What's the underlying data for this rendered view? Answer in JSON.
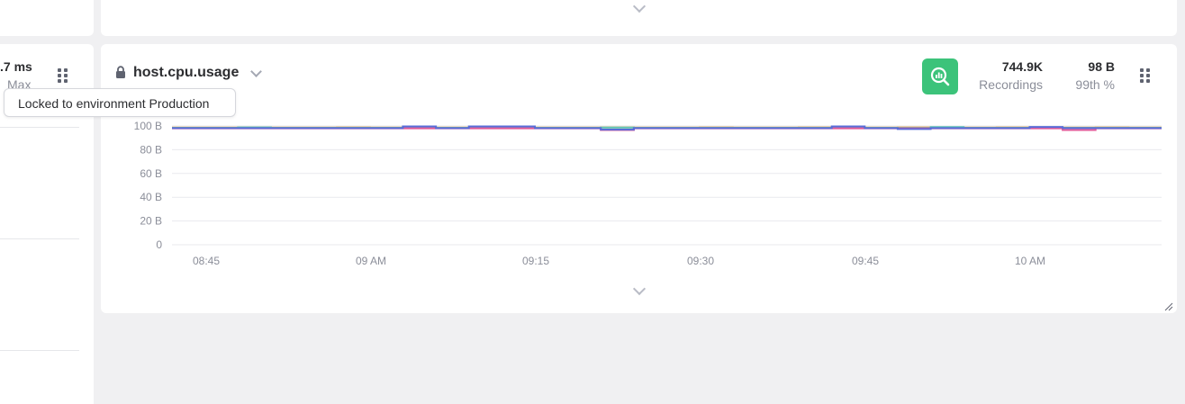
{
  "left_panel": {
    "value": ".7 ms",
    "sublabel": "Max"
  },
  "tooltip": {
    "text": "Locked to environment Production"
  },
  "widget": {
    "title": "host.cpu.usage",
    "accent_color": "#3cc37a",
    "analyze_icon": "analyze-chart-icon",
    "lock_icon": "lock-icon",
    "stats": [
      {
        "value": "744.9K",
        "label": "Recordings"
      },
      {
        "value": "98 B",
        "label": "99th %"
      }
    ]
  },
  "chart_data": {
    "type": "line",
    "y_tick_labels": [
      "100 B",
      "80 B",
      "60 B",
      "40 B",
      "20 B",
      "0"
    ],
    "x_tick_labels": [
      "08:45",
      "09 AM",
      "09:15",
      "09:30",
      "09:45",
      "10 AM"
    ],
    "ylim": [
      0,
      100
    ],
    "grid": true,
    "series": [
      {
        "color": "#e8a33c",
        "values": [
          98.6,
          98.6,
          98.8,
          98.6,
          98.6,
          98.8,
          98.6,
          98.8,
          98.6,
          98.6,
          98.8,
          98.6,
          98.6,
          98.8,
          98.6,
          98.6,
          98.8,
          98.6,
          98.6,
          98.8,
          98.6,
          98.6,
          98.8,
          98.6,
          98.6,
          98.8,
          98.6,
          98.6,
          98.8,
          98.6
        ]
      },
      {
        "color": "#5cc2b4",
        "values": [
          98.4,
          98.4,
          98.8,
          98.4,
          98.4,
          98.4,
          98.4,
          99.0,
          98.4,
          98.4,
          98.4,
          98.4,
          98.4,
          98.6,
          98.4,
          98.4,
          98.4,
          98.4,
          98.4,
          98.4,
          98.6,
          98.4,
          98.4,
          99.0,
          98.4,
          98.4,
          98.4,
          98.4,
          98.4,
          98.4
        ]
      },
      {
        "color": "#e05a9a",
        "values": [
          98.0,
          98.0,
          98.0,
          98.0,
          98.0,
          98.0,
          98.0,
          98.0,
          98.0,
          98.0,
          98.0,
          98.0,
          98.0,
          96.6,
          98.0,
          98.0,
          98.0,
          98.0,
          98.0,
          98.0,
          98.0,
          98.0,
          98.0,
          98.0,
          98.0,
          98.0,
          98.0,
          96.6,
          98.0,
          98.0
        ]
      },
      {
        "color": "#5a6cd8",
        "values": [
          98.2,
          98.2,
          98.2,
          98.2,
          98.2,
          98.2,
          98.2,
          99.6,
          98.2,
          99.6,
          99.6,
          98.2,
          98.2,
          97.0,
          98.2,
          98.2,
          98.2,
          98.2,
          98.2,
          98.2,
          99.6,
          98.2,
          97.4,
          98.2,
          98.2,
          98.2,
          99.2,
          98.2,
          98.2,
          98.2
        ]
      }
    ]
  }
}
